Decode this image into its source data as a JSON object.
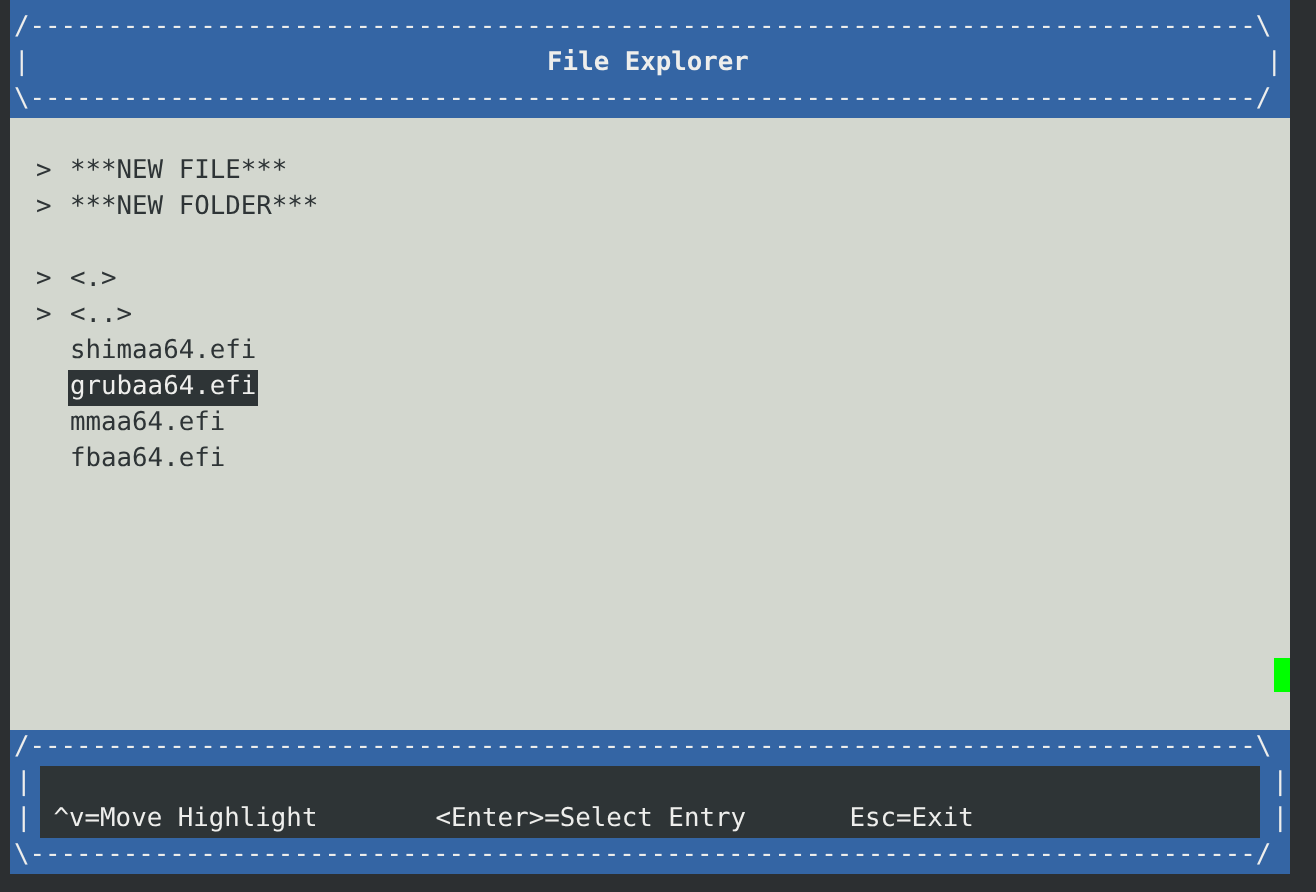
{
  "header": {
    "top_border": "/-------------------------------------------------------------------------------\\",
    "left_edge": "|",
    "title": "File Explorer",
    "right_edge": "|",
    "bottom_border": "\\-------------------------------------------------------------------------------/"
  },
  "sections": [
    [
      {
        "marker": ">",
        "label": "***NEW FILE***",
        "selected": false
      },
      {
        "marker": ">",
        "label": "***NEW FOLDER***",
        "selected": false
      }
    ],
    [
      {
        "marker": ">",
        "label": "<.>",
        "selected": false
      },
      {
        "marker": ">",
        "label": "<..>",
        "selected": false
      },
      {
        "label": "shimaa64.efi",
        "selected": false
      },
      {
        "label": "grubaa64.efi",
        "selected": true
      },
      {
        "label": "mmaa64.efi",
        "selected": false
      },
      {
        "label": "fbaa64.efi",
        "selected": false
      }
    ]
  ],
  "footer": {
    "top_border": "/-------------------------------------------------------------------------------\\",
    "left_edge": [
      "|",
      "|"
    ],
    "right_edge": [
      "|",
      "|"
    ],
    "hints": [
      "^v=Move Highlight",
      "<Enter>=Select Entry",
      "Esc=Exit"
    ],
    "bottom_border": "\\-------------------------------------------------------------------------------/"
  }
}
